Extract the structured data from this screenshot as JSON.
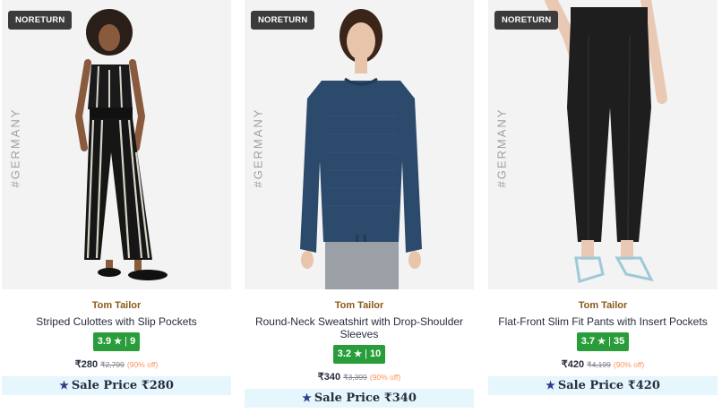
{
  "products": [
    {
      "badge": "NORETURN",
      "watermark": "#GERMANY",
      "brand": "Tom Tailor",
      "title": "Striped Culottes with Slip Pockets",
      "rating": "3.9",
      "rating_star": "★",
      "rating_sep": "|",
      "rating_count": "9",
      "price": "₹280",
      "mrp": "₹2,799",
      "discount": "(90% off)",
      "sale_label": "Sale Price ₹280",
      "sale_icon": "star-icon"
    },
    {
      "badge": "NORETURN",
      "watermark": "#GERMANY",
      "brand": "Tom Tailor",
      "title": "Round-Neck Sweatshirt with Drop-Shoulder Sleeves",
      "rating": "3.2",
      "rating_star": "★",
      "rating_sep": "|",
      "rating_count": "10",
      "price": "₹340",
      "mrp": "₹3,399",
      "discount": "(90% off)",
      "sale_label": "Sale Price ₹340",
      "sale_icon": "star-icon"
    },
    {
      "badge": "NORETURN",
      "watermark": "#GERMANY",
      "brand": "Tom Tailor",
      "title": "Flat-Front Slim Fit Pants with Insert Pockets",
      "rating": "3.7",
      "rating_star": "★",
      "rating_sep": "|",
      "rating_count": "35",
      "price": "₹420",
      "mrp": "₹4,199",
      "discount": "(90% off)",
      "sale_label": "Sale Price ₹420",
      "sale_icon": "star-icon"
    }
  ],
  "colors": {
    "brand": "#8b5a17",
    "rating_bg": "#2a9d3b",
    "sale_bg": "#e6f6fd",
    "discount": "#ff905a",
    "badge_bg": "#3b3b3b"
  }
}
